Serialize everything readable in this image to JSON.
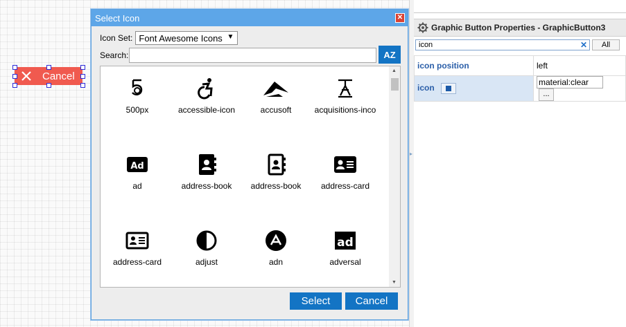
{
  "canvas": {
    "button_label": "Cancel"
  },
  "dialog": {
    "title": "Select Icon",
    "icon_set_label": "Icon Set:",
    "icon_set_value": "Font Awesome Icons",
    "search_label": "Search:",
    "search_value": "",
    "sort_label": "AZ",
    "icons": [
      {
        "name": "500px",
        "icon": "500px-icon"
      },
      {
        "name": "accessible-icon",
        "icon": "wheelchair-icon"
      },
      {
        "name": "accusoft",
        "icon": "accusoft-icon"
      },
      {
        "name": "acquisitions-inco",
        "icon": "acquisitions-icon"
      },
      {
        "name": "ad",
        "icon": "ad-icon"
      },
      {
        "name": "address-book",
        "icon": "address-book-icon"
      },
      {
        "name": "address-book",
        "icon": "address-book-outline-icon"
      },
      {
        "name": "address-card",
        "icon": "address-card-icon"
      },
      {
        "name": "address-card",
        "icon": "address-card-outline-icon"
      },
      {
        "name": "adjust",
        "icon": "adjust-icon"
      },
      {
        "name": "adn",
        "icon": "adn-icon"
      },
      {
        "name": "adversal",
        "icon": "adversal-icon"
      }
    ],
    "select_label": "Select",
    "cancel_label": "Cancel"
  },
  "properties": {
    "title": "Graphic Button Properties - GraphicButton3",
    "filter_value": "icon",
    "all_label": "All",
    "rows": [
      {
        "name": "icon position",
        "value": "left"
      },
      {
        "name": "icon",
        "value": "material:clear",
        "more_label": "..."
      }
    ]
  },
  "colors": {
    "accent": "#1374c4",
    "titlebar": "#5da6e8",
    "danger_button": "#f05a4f"
  }
}
